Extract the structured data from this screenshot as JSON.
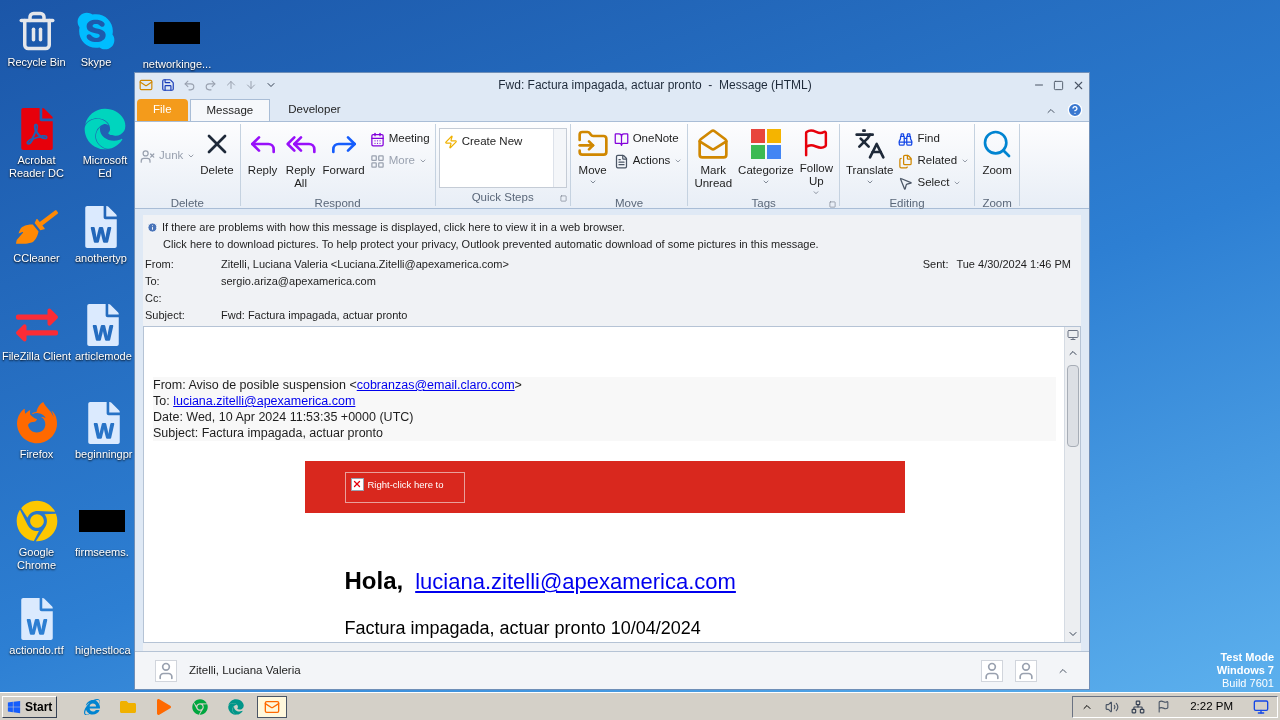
{
  "desktop": {
    "columns": [
      [
        {
          "kind": "recycle",
          "label": "Recycle Bin"
        },
        {
          "kind": "pdf",
          "label": "Acrobat\nReader DC"
        },
        {
          "kind": "ccleaner",
          "label": "CCleaner"
        },
        {
          "kind": "filezilla",
          "label": "FileZilla Client"
        },
        {
          "kind": "firefox",
          "label": "Firefox"
        },
        {
          "kind": "chrome",
          "label": "Google\nChrome"
        },
        {
          "kind": "word",
          "label": "actiondo.rtf"
        }
      ],
      [
        {
          "kind": "skype",
          "label": "Skype"
        },
        {
          "kind": "edge",
          "label": "Microsoft Ed"
        },
        {
          "kind": "word",
          "label": "anothertyp"
        },
        {
          "kind": "word",
          "label": "articlemode"
        },
        {
          "kind": "word",
          "label": "beginningpr"
        },
        {
          "kind": "redacted",
          "label": "firmseems."
        },
        {
          "kind": "blank",
          "label": "highestloca"
        }
      ],
      [
        {
          "kind": "redacted",
          "label": "networkinge..."
        }
      ]
    ],
    "notice": [
      "Test Mode",
      "Windows 7",
      "Build 7601"
    ]
  },
  "window": {
    "title": "Fwd: Factura impagada, actuar pronto  -  Message (HTML)",
    "tabs": [
      {
        "label": "File",
        "kind": "file",
        "selected": false
      },
      {
        "label": "Message",
        "kind": "tab",
        "selected": true
      },
      {
        "label": "Developer",
        "kind": "tab",
        "selected": false
      }
    ],
    "ribbon": [
      {
        "label": "Delete",
        "launcher": false,
        "columns": [
          {
            "kind": "stack",
            "items": [
              {
                "kind": "junk",
                "label": "Junk",
                "disabled": true,
                "dropdown": true
              }
            ]
          },
          {
            "kind": "large",
            "items": [
              {
                "kind": "delete",
                "label": "Delete",
                "disabled": false,
                "dropdown": false
              }
            ]
          }
        ]
      },
      {
        "label": "Respond",
        "launcher": false,
        "columns": [
          {
            "kind": "large",
            "items": [
              {
                "kind": "reply",
                "label": "Reply",
                "disabled": false,
                "dropdown": false
              }
            ]
          },
          {
            "kind": "large",
            "items": [
              {
                "kind": "reply_all",
                "label": "Reply\nAll",
                "disabled": false,
                "dropdown": false
              }
            ]
          },
          {
            "kind": "large",
            "items": [
              {
                "kind": "forward",
                "label": "Forward",
                "disabled": false,
                "dropdown": false
              }
            ]
          },
          {
            "kind": "stack",
            "items": [
              {
                "kind": "meeting",
                "label": "Meeting",
                "disabled": false,
                "dropdown": false
              },
              {
                "kind": "more",
                "label": "More",
                "disabled": true,
                "dropdown": true
              }
            ]
          }
        ]
      },
      {
        "label": "Quick Steps",
        "launcher": true,
        "gallery": [
          {
            "kind": "quickstep",
            "label": "Create New"
          }
        ]
      },
      {
        "label": "Move",
        "launcher": false,
        "columns": [
          {
            "kind": "large",
            "items": [
              {
                "kind": "move",
                "label": "Move",
                "disabled": false,
                "dropdown": true
              }
            ]
          },
          {
            "kind": "stack",
            "items": [
              {
                "kind": "onenote",
                "label": "OneNote",
                "disabled": false,
                "dropdown": false
              },
              {
                "kind": "actions",
                "label": "Actions",
                "disabled": false,
                "dropdown": true
              }
            ]
          }
        ]
      },
      {
        "label": "Tags",
        "launcher": true,
        "columns": [
          {
            "kind": "large",
            "items": [
              {
                "kind": "mark_unread",
                "label": "Mark\nUnread",
                "disabled": false,
                "dropdown": false
              }
            ]
          },
          {
            "kind": "large",
            "items": [
              {
                "kind": "categorize",
                "label": "Categorize",
                "disabled": false,
                "dropdown": true
              }
            ]
          },
          {
            "kind": "large",
            "items": [
              {
                "kind": "follow_up",
                "label": "Follow\nUp",
                "disabled": false,
                "dropdown": true
              }
            ]
          }
        ]
      },
      {
        "label": "Editing",
        "launcher": false,
        "columns": [
          {
            "kind": "large",
            "items": [
              {
                "kind": "translate",
                "label": "Translate",
                "disabled": false,
                "dropdown": true
              }
            ]
          },
          {
            "kind": "stack",
            "items": [
              {
                "kind": "find",
                "label": "Find",
                "disabled": false,
                "dropdown": false
              },
              {
                "kind": "related",
                "label": "Related",
                "disabled": false,
                "dropdown": true
              },
              {
                "kind": "select",
                "label": "Select",
                "disabled": false,
                "dropdown": true
              }
            ]
          }
        ]
      },
      {
        "label": "Zoom",
        "launcher": false,
        "columns": [
          {
            "kind": "large",
            "items": [
              {
                "kind": "zoom",
                "label": "Zoom",
                "disabled": false,
                "dropdown": false
              }
            ]
          }
        ]
      }
    ],
    "infobar": [
      "If there are problems with how this message is displayed, click here to view it in a web browser.",
      "Click here to download pictures. To help protect your privacy, Outlook prevented automatic download of some pictures in this message."
    ],
    "fields": [
      {
        "label": "From:",
        "value": "Zitelli, Luciana Valeria <Luciana.Zitelli@apexamerica.com>"
      },
      {
        "label": "To:",
        "value": "sergio.ariza@apexamerica.com"
      },
      {
        "label": "Cc:"
      },
      {
        "label": "Subject:",
        "value": "Fwd: Factura impagada, actuar pronto"
      }
    ],
    "sent": {
      "label": "Sent:",
      "value": "Tue 4/30/2024 1:46 PM"
    },
    "message": {
      "forward_header": [
        [
          {
            "text": "From: Aviso de posible suspension <"
          },
          {
            "link": "cobranzas@email.claro.com"
          },
          {
            "text": ">"
          }
        ],
        [
          {
            "text": "To: "
          },
          {
            "link": "luciana.zitelli@apexamerica.com"
          }
        ],
        [
          {
            "text": "Date: Wed, 10 Apr 2024 11:53:35 +0000 (UTC)"
          }
        ],
        [
          {
            "text": "Subject: Factura impagada, actuar pronto"
          }
        ]
      ],
      "banner_placeholder": "Right-click here to",
      "greeting": "Hola,",
      "greeting_link": "luciana.zitelli@apexamerica.com",
      "heading": "Factura impagada, actuar pronto 10/04/2024"
    },
    "people_pane": {
      "name": "Zitelli, Luciana Valeria"
    }
  },
  "taskbar": {
    "start": "Start",
    "apps": [
      {
        "kind": "ie",
        "selected": false
      },
      {
        "kind": "explorer",
        "selected": false
      },
      {
        "kind": "media",
        "selected": false
      },
      {
        "kind": "chrome",
        "selected": false
      },
      {
        "kind": "edge",
        "selected": false
      },
      {
        "kind": "outlook",
        "selected": true
      }
    ],
    "clock": "2:22 PM"
  }
}
